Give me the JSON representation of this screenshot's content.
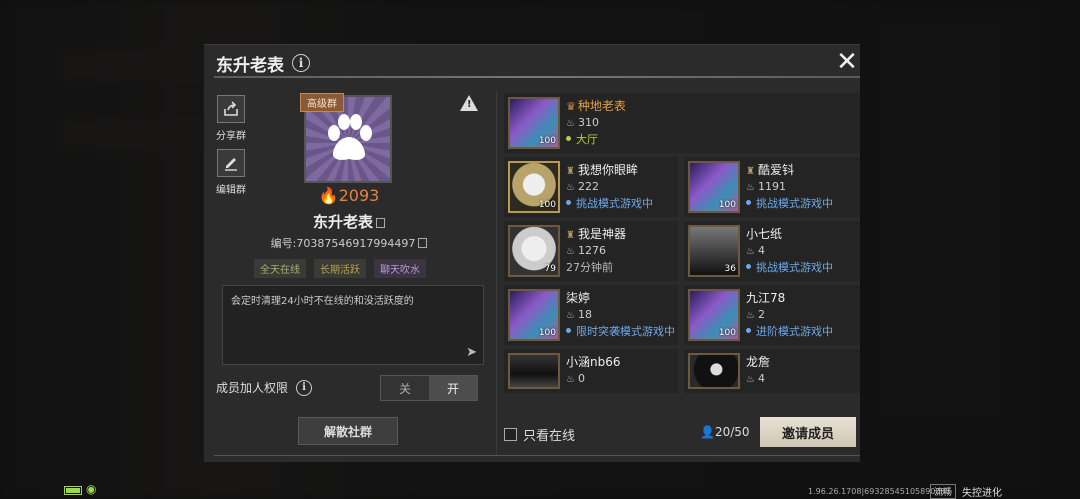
{
  "dialog": {
    "title": "东升老表",
    "info_glyph": "i",
    "close_glyph": "✕"
  },
  "left": {
    "share_label": "分享群",
    "edit_label": "编辑群",
    "rank_tag": "高级群",
    "warning_glyph": "!",
    "fire_count": "2093",
    "group_name": "东升老表",
    "group_id": "编号:70387546917994497",
    "tags": [
      "全天在线",
      "长期活跃",
      "聊天吹水"
    ],
    "description": "会定时清理24小时不在线的和没活跃度的",
    "permission_label": "成员加人权限",
    "toggle_off": "关",
    "toggle_on": "开",
    "dissolve_label": "解散社群"
  },
  "members": [
    {
      "name": "种地老表",
      "score": "310",
      "status": "大厅",
      "status_color": "green",
      "level": "100",
      "avatar": "purple",
      "leader": true
    },
    {
      "name": "我想你眼眸",
      "score": "222",
      "status": "挑战模式游戏中",
      "status_color": "blue",
      "level": "100",
      "avatar": "gold"
    },
    {
      "name": "酷爱钭",
      "score": "1191",
      "status": "挑战模式游戏中",
      "status_color": "blue",
      "level": "100",
      "avatar": "purple"
    },
    {
      "name": "我是神器",
      "score": "1276",
      "status": "27分钟前",
      "status_color": "gray",
      "level": "79",
      "avatar": "sketch"
    },
    {
      "name": "小七纸",
      "score": "4",
      "status": "挑战模式游戏中",
      "status_color": "blue",
      "level": "36",
      "avatar": "bw"
    },
    {
      "name": "柒婷",
      "score": "18",
      "status": "限时突袭模式游戏中",
      "status_color": "blue",
      "level": "100",
      "avatar": "purple"
    },
    {
      "name": "九江78",
      "score": "2",
      "status": "进阶模式游戏中",
      "status_color": "blue",
      "level": "100",
      "avatar": "purple"
    },
    {
      "name": "小涵nb66",
      "score": "0",
      "status": "",
      "status_color": "gray",
      "level": "",
      "avatar": "bw2"
    },
    {
      "name": "龙詹",
      "score": "4",
      "status": "",
      "status_color": "gray",
      "level": "",
      "avatar": "hair"
    }
  ],
  "footer": {
    "online_only_label": "只看在线",
    "member_count": "20/50",
    "invite_label": "邀请成员"
  },
  "statusbar": {
    "version": "1.96.26.1708|69328545105890081",
    "flow_label": "流畅",
    "brand": "失控进化"
  }
}
